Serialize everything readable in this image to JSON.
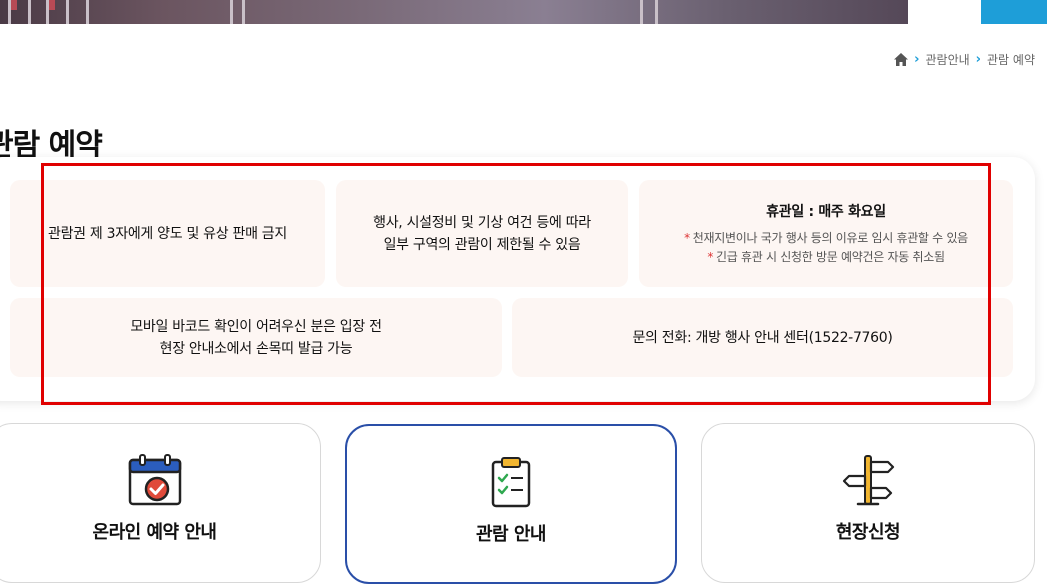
{
  "breadcrumb": {
    "home_icon": "home-icon",
    "items": [
      "관람안내",
      "관람 예약"
    ]
  },
  "page": {
    "title": "관람 예약"
  },
  "notices": {
    "resale": "관람권 제 3자에게 양도 및 유상 판매 금지",
    "restriction_line1": "행사, 시설정비 및 기상 여건 등에 따라",
    "restriction_line2": "일부 구역의 관람이 제한될 수 있음",
    "closed_title": "휴관일 : 매주 화요일",
    "closed_note1": "천재지변이나 국가 행사 등의 이유로 임시 휴관할 수 있음",
    "closed_note2": "긴급 휴관 시 신청한 방문 예약건은 자동 취소됨",
    "barcode_line1": "모바일 바코드 확인이 어려우신 분은 입장 전",
    "barcode_line2": "현장 안내소에서 손목띠 발급 가능",
    "contact": "문의 전화: 개방 행사 안내 센터(1522-7760)",
    "star": "*"
  },
  "nav_cards": [
    {
      "label": "온라인 예약 안내",
      "icon": "calendar-check-icon"
    },
    {
      "label": "관람 안내",
      "icon": "clipboard-checklist-icon"
    },
    {
      "label": "현장신청",
      "icon": "signpost-icon"
    }
  ],
  "colors": {
    "accent": "#1e9ed8",
    "highlight": "#e00000",
    "active_border": "#2a4fa8",
    "card_bg": "#fdf6f3"
  }
}
